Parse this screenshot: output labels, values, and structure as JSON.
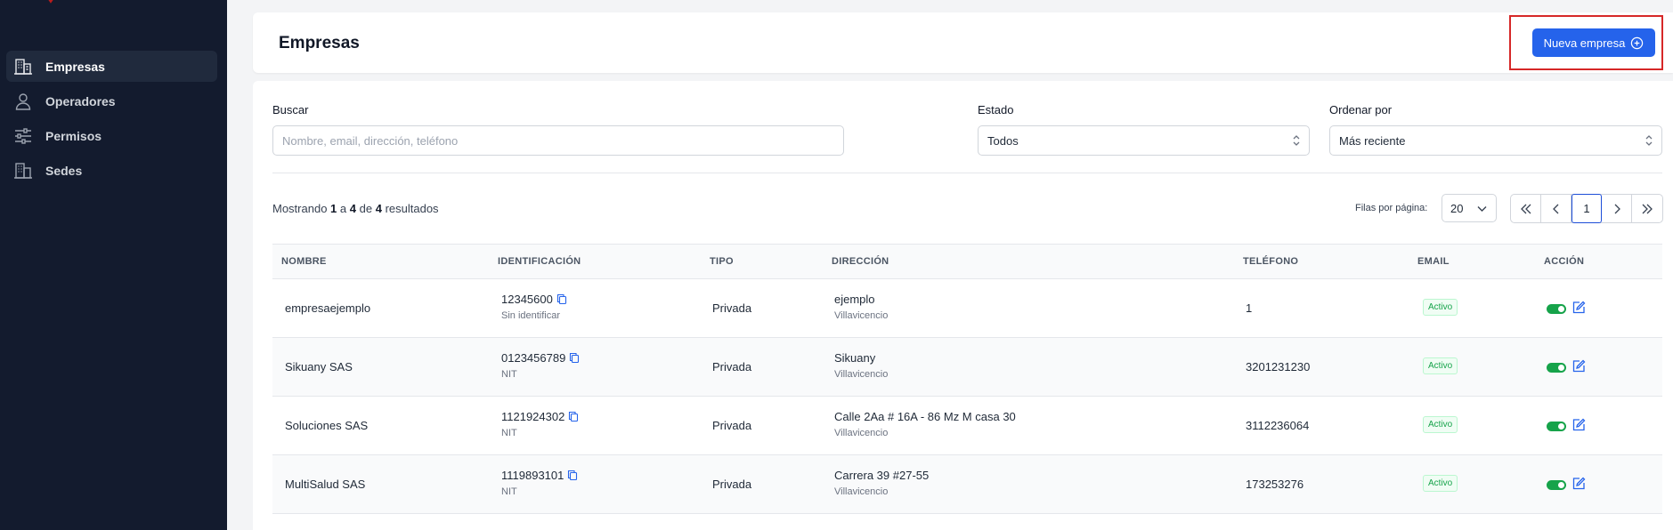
{
  "sidebar": {
    "items": [
      {
        "label": "Empresas",
        "icon": "building-icon",
        "active": true
      },
      {
        "label": "Operadores",
        "icon": "user-icon",
        "active": false
      },
      {
        "label": "Permisos",
        "icon": "sliders-icon",
        "active": false
      },
      {
        "label": "Sedes",
        "icon": "office-icon",
        "active": false
      }
    ]
  },
  "header": {
    "title": "Empresas",
    "new_button": "Nueva empresa"
  },
  "filters": {
    "search_label": "Buscar",
    "search_placeholder": "Nombre, email, dirección, teléfono",
    "status_label": "Estado",
    "status_value": "Todos",
    "sort_label": "Ordenar por",
    "sort_value": "Más reciente"
  },
  "results": {
    "prefix": "Mostrando",
    "from": "1",
    "to_word": "a",
    "to": "4",
    "of_word": "de",
    "total": "4",
    "suffix": "resultados"
  },
  "pagination": {
    "rows_label": "Filas por página:",
    "rows_value": "20",
    "current_page": "1"
  },
  "table": {
    "columns": [
      "NOMBRE",
      "IDENTIFICACIÓN",
      "TIPO",
      "DIRECCIÓN",
      "TELÉFONO",
      "EMAIL",
      "ACCIÓN"
    ],
    "rows": [
      {
        "name": "empresaejemplo",
        "id": "12345600",
        "id_type": "Sin identificar",
        "type": "Privada",
        "address": "ejemplo",
        "city": "Villavicencio",
        "phone": "1",
        "status": "Activo"
      },
      {
        "name": "Sikuany SAS",
        "id": "0123456789",
        "id_type": "NIT",
        "type": "Privada",
        "address": "Sikuany",
        "city": "Villavicencio",
        "phone": "3201231230",
        "status": "Activo"
      },
      {
        "name": "Soluciones SAS",
        "id": "1121924302",
        "id_type": "NIT",
        "type": "Privada",
        "address": "Calle 2Aa # 16A - 86 Mz M casa 30",
        "city": "Villavicencio",
        "phone": "3112236064",
        "status": "Activo"
      },
      {
        "name": "MultiSalud SAS",
        "id": "1119893101",
        "id_type": "NIT",
        "type": "Privada",
        "address": "Carrera 39 #27-55",
        "city": "Villavicencio",
        "phone": "173253276",
        "status": "Activo"
      }
    ]
  },
  "colors": {
    "sidebar_bg": "#131b2e",
    "primary": "#2563eb",
    "success": "#16a34a",
    "highlight": "#d62828"
  }
}
